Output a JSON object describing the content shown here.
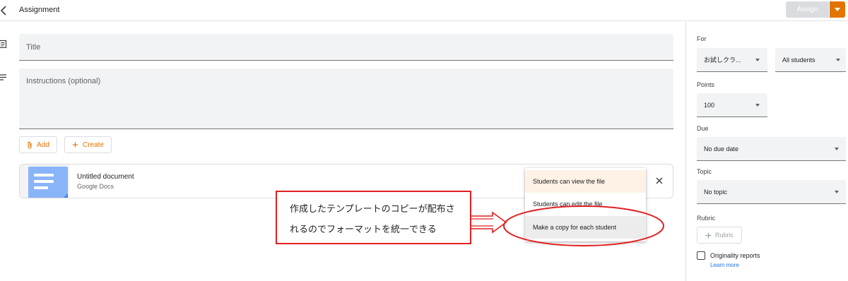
{
  "header": {
    "title": "Assignment",
    "assign_label": "Assign",
    "accent_color": "#e37400"
  },
  "form": {
    "title_label": "Title",
    "instructions_label": "Instructions (optional)",
    "add_label": "Add",
    "create_label": "Create"
  },
  "attachment": {
    "title": "Untitled document",
    "source": "Google Docs",
    "icon": "google-docs-icon"
  },
  "share_menu": {
    "items": [
      {
        "label": "Students can view the file",
        "state": "highlighted"
      },
      {
        "label": "Students can edit the file",
        "state": "normal"
      },
      {
        "label": "Make a copy for each student",
        "state": "hovered"
      }
    ]
  },
  "callout": {
    "line1": "作成したテンプレートのコピーが配布さ",
    "line2": "れるのでフォーマットを統一できる",
    "border_color": "#e02020"
  },
  "sidebar": {
    "for_label": "For",
    "class_value": "お試しクラ...",
    "students_value": "All students",
    "points_label": "Points",
    "points_value": "100",
    "due_label": "Due",
    "due_value": "No due date",
    "topic_label": "Topic",
    "topic_value": "No topic",
    "rubric_label": "Rubric",
    "rubric_button": "Rubric",
    "originality_label": "Originality reports",
    "learn_more": "Learn more"
  }
}
